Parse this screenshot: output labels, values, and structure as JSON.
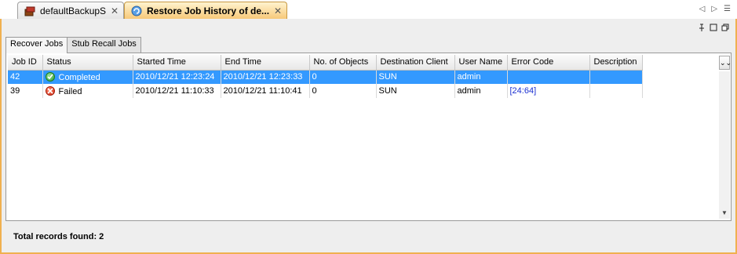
{
  "editor_tabs": [
    {
      "label": "defaultBackupSet",
      "close": "✕"
    },
    {
      "label": "Restore Job History of de...",
      "close": "✕"
    }
  ],
  "subtabs": [
    "Recover Jobs",
    "Stub Recall Jobs"
  ],
  "table": {
    "columns": [
      "Job ID",
      "Status",
      "Started Time",
      "End Time",
      "No. of Objects",
      "Destination Client",
      "User Name",
      "Error Code",
      "Description"
    ],
    "rows": [
      {
        "job_id": "42",
        "status": "Completed",
        "started": "2010/12/21 12:23:24",
        "ended": "2010/12/21 12:23:33",
        "objects": "0",
        "destination": "SUN",
        "user": "admin",
        "error": "",
        "description": ""
      },
      {
        "job_id": "39",
        "status": "Failed",
        "started": "2010/12/21 11:10:33",
        "ended": "2010/12/21 11:10:41",
        "objects": "0",
        "destination": "SUN",
        "user": "admin",
        "error": "[24:64]",
        "description": ""
      }
    ]
  },
  "footer": {
    "total": "Total records found: 2"
  },
  "colors": {
    "accent": "#f0b050",
    "selection": "#3399ff",
    "link": "#1a2fd1"
  }
}
